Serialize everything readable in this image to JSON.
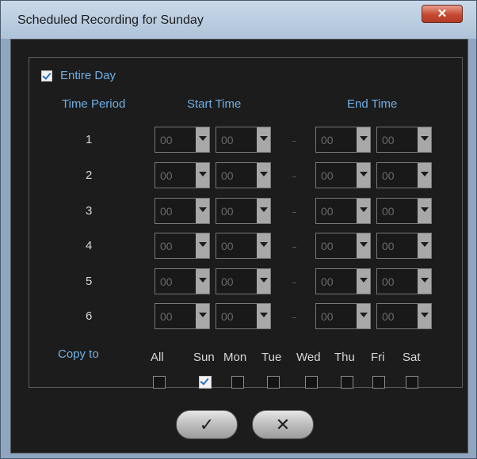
{
  "window": {
    "title": "Scheduled Recording for Sunday",
    "close_glyph": "✕"
  },
  "entire_day": {
    "label": "Entire Day",
    "checked": true
  },
  "headers": {
    "time_period": "Time Period",
    "start_time": "Start Time",
    "end_time": "End Time"
  },
  "rows": [
    {
      "period": "1",
      "start_hour": "00",
      "start_min": "00",
      "end_hour": "00",
      "end_min": "00"
    },
    {
      "period": "2",
      "start_hour": "00",
      "start_min": "00",
      "end_hour": "00",
      "end_min": "00"
    },
    {
      "period": "3",
      "start_hour": "00",
      "start_min": "00",
      "end_hour": "00",
      "end_min": "00"
    },
    {
      "period": "4",
      "start_hour": "00",
      "start_min": "00",
      "end_hour": "00",
      "end_min": "00"
    },
    {
      "period": "5",
      "start_hour": "00",
      "start_min": "00",
      "end_hour": "00",
      "end_min": "00"
    },
    {
      "period": "6",
      "start_hour": "00",
      "start_min": "00",
      "end_hour": "00",
      "end_min": "00"
    }
  ],
  "copy_to": {
    "label": "Copy to",
    "days": [
      {
        "label": "All",
        "checked": false
      },
      {
        "label": "Sun",
        "checked": true
      },
      {
        "label": "Mon",
        "checked": false
      },
      {
        "label": "Tue",
        "checked": false
      },
      {
        "label": "Wed",
        "checked": false
      },
      {
        "label": "Thu",
        "checked": false
      },
      {
        "label": "Fri",
        "checked": false
      },
      {
        "label": "Sat",
        "checked": false
      }
    ]
  },
  "buttons": {
    "ok_glyph": "✓",
    "cancel_glyph": "✕"
  }
}
